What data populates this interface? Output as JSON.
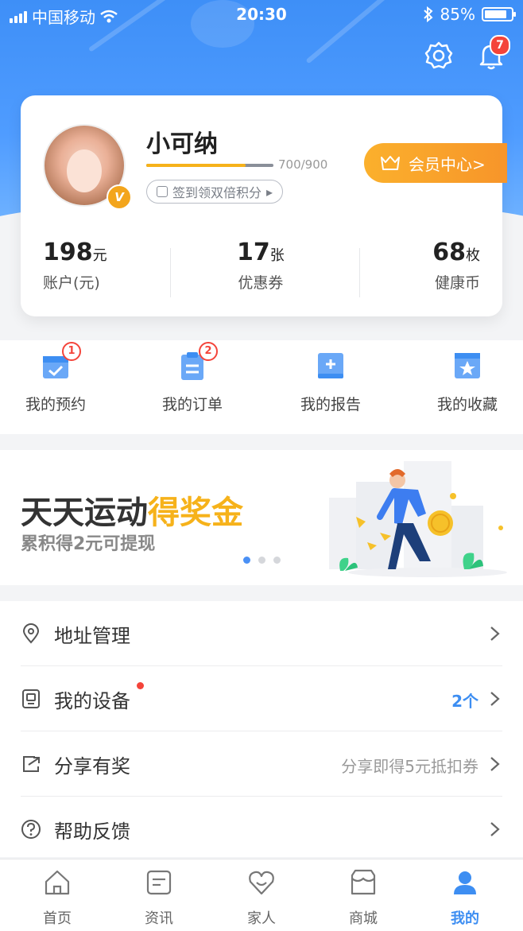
{
  "status_bar": {
    "carrier": "中国移动",
    "time": "20:30",
    "battery": "85%",
    "battery_level": 0.85
  },
  "header": {
    "notification_count": "7"
  },
  "profile": {
    "name": "小可纳",
    "points_progress": "700/900",
    "points_fraction": 0.78,
    "checkin_label": "签到领双倍积分",
    "checkin_arrow": "▸",
    "member_label": "会员中心>"
  },
  "stats": [
    {
      "value": "198",
      "unit": "元",
      "label": "账户(元)"
    },
    {
      "value": "17",
      "unit": "张",
      "label": "优惠券"
    },
    {
      "value": "68",
      "unit": "枚",
      "label": "健康币"
    }
  ],
  "quick_actions": [
    {
      "label": "我的预约",
      "badge": "1"
    },
    {
      "label": "我的订单",
      "badge": "2"
    },
    {
      "label": "我的报告"
    },
    {
      "label": "我的收藏"
    }
  ],
  "banner": {
    "title_main": "天天运动",
    "title_highlight": "得奖金",
    "subtitle": "累积得2元可提现"
  },
  "menu": [
    {
      "label": "地址管理",
      "value": ""
    },
    {
      "label": "我的设备",
      "value": "2个"
    },
    {
      "label": "分享有奖",
      "value": "分享即得5元抵扣券"
    },
    {
      "label": "帮助反馈",
      "value": ""
    }
  ],
  "tabs": [
    {
      "label": "首页",
      "icon": "home-icon"
    },
    {
      "label": "资讯",
      "icon": "news-icon"
    },
    {
      "label": "家人",
      "icon": "family-icon"
    },
    {
      "label": "商城",
      "icon": "store-icon"
    },
    {
      "label": "我的",
      "icon": "profile-icon",
      "active": true
    }
  ],
  "colors": {
    "accent": "#3d8ef2",
    "gold": "#f6b21a",
    "badge": "#f4443a"
  }
}
